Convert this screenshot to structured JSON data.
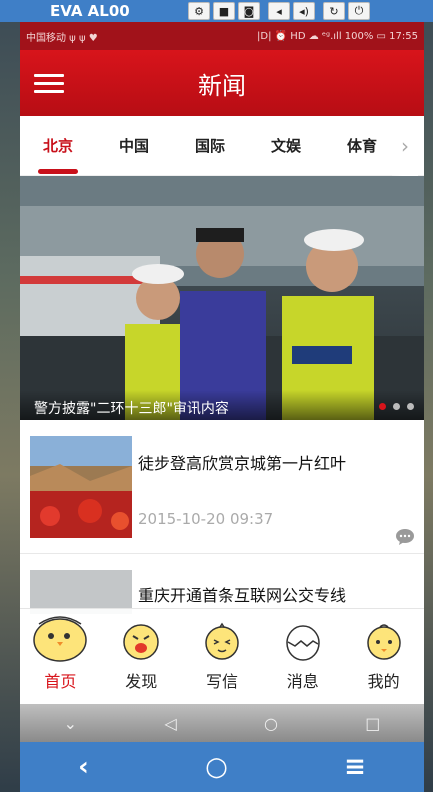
{
  "emulator": {
    "title": "EVA AL00",
    "buttons": [
      "gear-icon",
      "video-icon",
      "camera-icon",
      "volume-down-icon",
      "volume-up-icon",
      "rotate-icon",
      "power-icon"
    ],
    "nav": {
      "back": "‹",
      "home": "○",
      "menu": "≡"
    }
  },
  "status_bar": {
    "left": "中国移动 ψ ψ ♥",
    "right": "|D| ⏰ HD ☁ ᵉᵍ.ıll 100% ▭ 17:55"
  },
  "header": {
    "title": "新闻"
  },
  "tabs": [
    {
      "label": "北京",
      "active": true
    },
    {
      "label": "中国",
      "active": false
    },
    {
      "label": "国际",
      "active": false
    },
    {
      "label": "文娱",
      "active": false
    },
    {
      "label": "体育",
      "active": false
    }
  ],
  "banner": {
    "caption": "警方披露\"二环十三郎\"审讯内容",
    "slide_count": 3,
    "active_slide": 1
  },
  "news": [
    {
      "title": "徒步登高欣赏京城第一片红叶",
      "time": "2015-10-20 09:37"
    },
    {
      "title": "重庆开通首条互联网公交专线",
      "time": ""
    }
  ],
  "bottom_nav": [
    {
      "label": "首页",
      "icon": "chick-home-icon",
      "active": true
    },
    {
      "label": "发现",
      "icon": "chick-discover-icon",
      "active": false
    },
    {
      "label": "写信",
      "icon": "chick-write-icon",
      "active": false
    },
    {
      "label": "消息",
      "icon": "egg-message-icon",
      "active": false
    },
    {
      "label": "我的",
      "icon": "chick-me-icon",
      "active": false
    }
  ],
  "colors": {
    "brand_red": "#d8141b",
    "emulator_blue": "#3f7fc7"
  }
}
